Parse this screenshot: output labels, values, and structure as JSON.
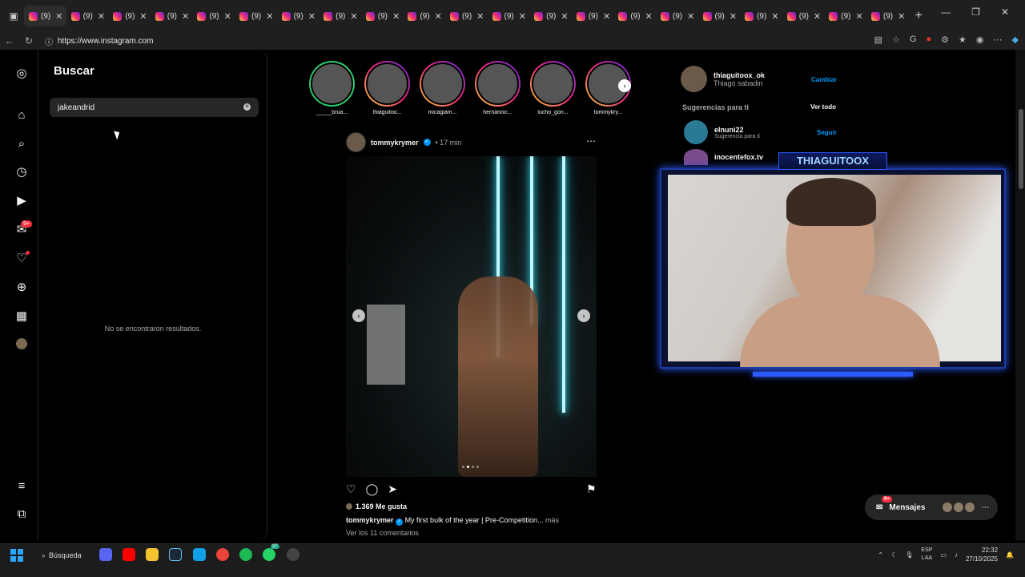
{
  "browser": {
    "tab_label": "(9)",
    "tab_count": 21,
    "url": "https://www.instagram.com"
  },
  "search_panel": {
    "title": "Buscar",
    "query": "jakeandrid",
    "empty_message": "No se encontraron resultados.",
    "clear_icon": "clear-icon"
  },
  "nav": {
    "notifications_badge": "9+"
  },
  "stories": [
    {
      "name": "_____brua...",
      "ring": "green"
    },
    {
      "name": "thiaguitoo...",
      "ring": "gradient"
    },
    {
      "name": "micagiam...",
      "ring": "gradient"
    },
    {
      "name": "hernannic...",
      "ring": "gradient"
    },
    {
      "name": "lucho_gon...",
      "ring": "gradient"
    },
    {
      "name": "tommykry...",
      "ring": "gradient"
    }
  ],
  "post": {
    "username": "tommykrymer",
    "time": "• 17 min",
    "likes": "1.369 Me gusta",
    "caption_user": "tommykrymer",
    "caption_text": "My first bulk of the year | Pre-Competition...",
    "caption_more": "más",
    "comments": "Ver los 11 comentarios"
  },
  "profile": {
    "username": "thiaguitoox_ok",
    "name": "Thiago sabadin",
    "switch": "Cambiar"
  },
  "suggestions": {
    "title": "Sugerencias para ti",
    "see_all": "Ver todo",
    "items": [
      {
        "username": "elnuni22",
        "subtitle": "Sugerencia para ti",
        "action": "Seguir"
      },
      {
        "username": "inocentefox.tv"
      }
    ]
  },
  "webcam": {
    "label": "THIAGUITOOX"
  },
  "messages": {
    "label": "Mensajes",
    "badge": "9+"
  },
  "taskbar": {
    "search": "Búsqueda",
    "lang_top": "ESP",
    "lang_bottom": "LAA",
    "time": "22:32",
    "date": "27/10/2025",
    "badge": "27"
  },
  "colors": {
    "accent": "#0095f6",
    "notification": "#ff3040",
    "webcam_glow": "#2d5bff"
  }
}
